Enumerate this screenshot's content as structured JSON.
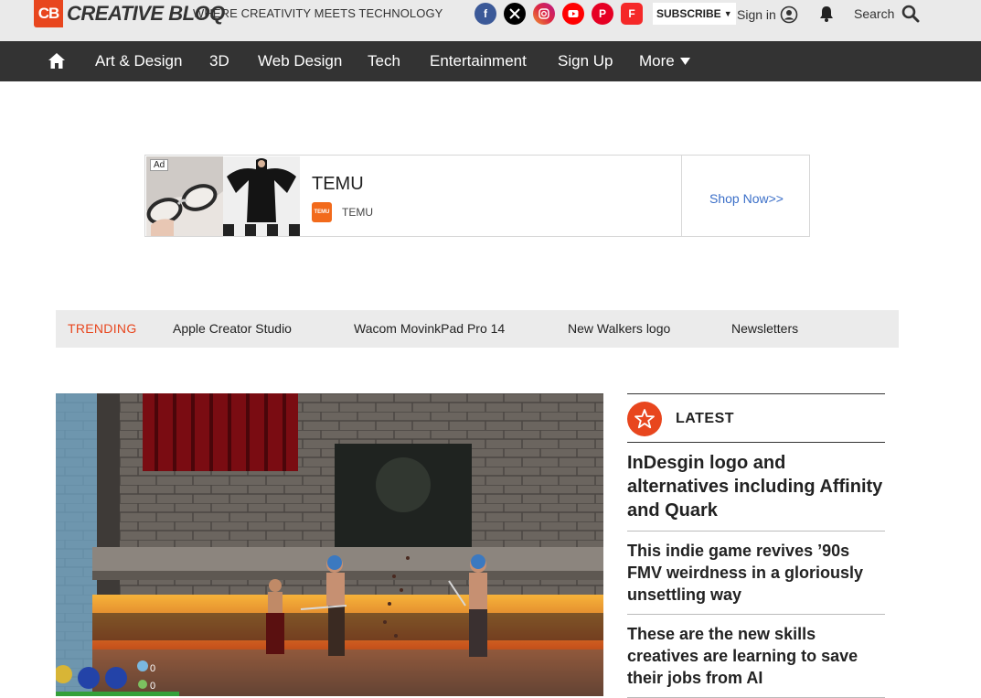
{
  "header": {
    "logo_mark": "CB",
    "logo_text": "CREATIVE BLOQ",
    "tagline": "WHERE CREATIVITY MEETS TECHNOLOGY",
    "socials": [
      {
        "name": "facebook",
        "glyph": "f",
        "color": "#3b5998"
      },
      {
        "name": "x",
        "glyph": "𝕏",
        "color": "#000000"
      },
      {
        "name": "instagram",
        "glyph": "◎",
        "color": "#d6249f"
      },
      {
        "name": "youtube",
        "glyph": "▶",
        "color": "#ff0000"
      },
      {
        "name": "pinterest",
        "glyph": "P",
        "color": "#e60023"
      },
      {
        "name": "flipboard",
        "glyph": "F",
        "color": "#f52828"
      }
    ],
    "subscribe_label": "SUBSCRIBE",
    "signin_label": "Sign in",
    "search_label": "Search"
  },
  "nav": {
    "items": [
      "Art & Design",
      "3D",
      "Web Design",
      "Tech",
      "Entertainment",
      "Sign Up"
    ],
    "more_label": "More"
  },
  "ad": {
    "badge": "Ad",
    "title": "TEMU",
    "brand": "TEMU",
    "brand_icon_text": "TEMU",
    "cta": "Shop Now>>"
  },
  "trending": {
    "label": "TRENDING",
    "items": [
      "Apple Creator Studio",
      "Wacom MovinkPad Pro 14",
      "New Walkers logo",
      "Newsletters"
    ]
  },
  "hero": {
    "hud_counts": [
      "0",
      "0"
    ]
  },
  "latest": {
    "label": "LATEST",
    "articles": [
      "InDesgin logo and alternatives including Affinity and Quark",
      "This indie game revives ’90s FMV weirdness in a gloriously unsettling way",
      "These are the new skills creatives are learning to save their jobs from AI"
    ]
  },
  "colors": {
    "brand": "#e8461e",
    "nav_bg": "#333333",
    "topbar_bg": "#eaeaea",
    "link_blue": "#3b6fc8"
  }
}
